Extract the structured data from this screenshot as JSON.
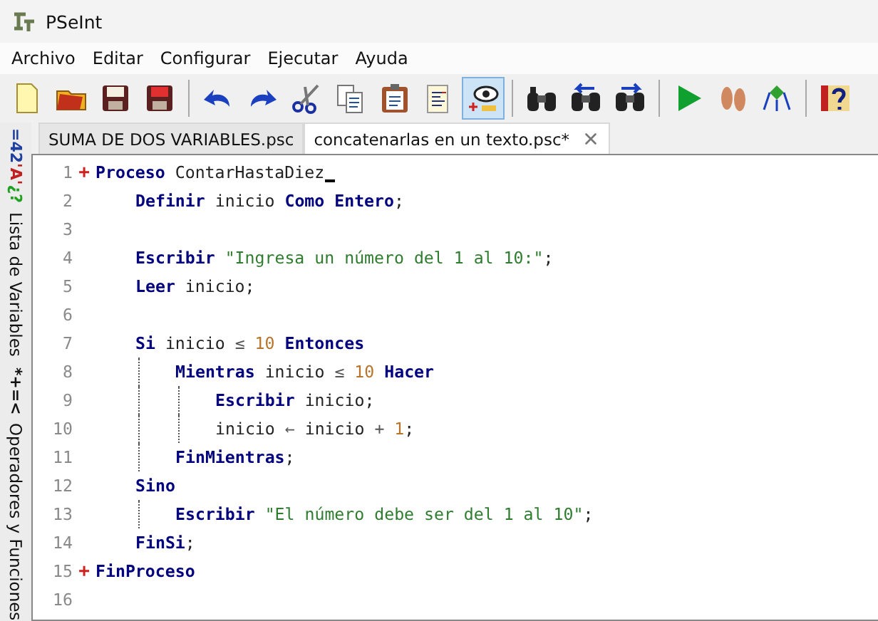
{
  "window": {
    "title": "PSeInt"
  },
  "menu": [
    "Archivo",
    "Editar",
    "Configurar",
    "Ejecutar",
    "Ayuda"
  ],
  "toolbar": [
    {
      "kind": "new",
      "selected": false
    },
    {
      "kind": "open",
      "selected": false
    },
    {
      "kind": "save",
      "selected": false
    },
    {
      "kind": "saveas",
      "selected": false
    },
    {
      "kind": "separator"
    },
    {
      "kind": "undo",
      "selected": false
    },
    {
      "kind": "redo",
      "selected": false
    },
    {
      "kind": "cut",
      "selected": false
    },
    {
      "kind": "copy",
      "selected": false
    },
    {
      "kind": "paste",
      "selected": false
    },
    {
      "kind": "document",
      "selected": false
    },
    {
      "kind": "eye",
      "selected": true
    },
    {
      "kind": "separator"
    },
    {
      "kind": "binoculars",
      "selected": false
    },
    {
      "kind": "binoculars-prev",
      "selected": false
    },
    {
      "kind": "binoculars-next",
      "selected": false
    },
    {
      "kind": "separator"
    },
    {
      "kind": "run",
      "selected": false
    },
    {
      "kind": "steps",
      "selected": false
    },
    {
      "kind": "flowchart",
      "selected": false
    },
    {
      "kind": "separator"
    },
    {
      "kind": "help",
      "selected": false
    }
  ],
  "side_panels": [
    {
      "glyphs": [
        {
          "text": "=42",
          "color": "#2040a0"
        },
        {
          "text": "'A'",
          "color": "#c02020"
        },
        {
          "text": "¿?",
          "color": "#20a020"
        }
      ],
      "label": "Lista de Variables"
    },
    {
      "glyphs": [
        {
          "text": "*+=<",
          "color": "#101010"
        }
      ],
      "label": "Operadores y Funciones"
    }
  ],
  "tabs": [
    {
      "label": "SUMA DE DOS VARIABLES.psc",
      "selected": false,
      "closable": false
    },
    {
      "label": "concatenarlas en un texto.psc*",
      "selected": true,
      "closable": true
    }
  ],
  "editor": {
    "lines": [
      {
        "number": "1",
        "fold": "+",
        "cursor": true,
        "tokens": [
          {
            "kind": "keyword",
            "text": "Proceso"
          },
          {
            "kind": "plain",
            "text": " ContarHastaDiez"
          }
        ],
        "children": [
          {
            "number": "2",
            "tokens": [
              {
                "kind": "keyword",
                "text": "Definir"
              },
              {
                "kind": "plain",
                "text": " inicio "
              },
              {
                "kind": "keyword",
                "text": "Como Entero"
              },
              {
                "kind": "plain",
                "text": ";"
              }
            ]
          },
          {
            "number": "3"
          },
          {
            "number": "4",
            "tokens": [
              {
                "kind": "keyword",
                "text": "Escribir"
              },
              {
                "kind": "string",
                "text": " \"Ingresa un número del 1 al 10:\""
              },
              {
                "kind": "plain",
                "text": ";"
              }
            ]
          },
          {
            "number": "5",
            "tokens": [
              {
                "kind": "keyword",
                "text": "Leer"
              },
              {
                "kind": "plain",
                "text": " inicio;"
              }
            ]
          },
          {
            "number": "6"
          },
          {
            "number": "7",
            "tokens": [
              {
                "kind": "keyword",
                "text": "Si"
              },
              {
                "kind": "plain",
                "text": " inicio "
              },
              {
                "kind": "operator",
                "text": "≤"
              },
              {
                "kind": "number",
                "text": " 10"
              },
              {
                "kind": "keyword",
                "text": " Entonces"
              }
            ],
            "children": [
              {
                "number": "8",
                "tokens": [
                  {
                    "kind": "keyword",
                    "text": "Mientras"
                  },
                  {
                    "kind": "plain",
                    "text": " inicio "
                  },
                  {
                    "kind": "operator",
                    "text": "≤"
                  },
                  {
                    "kind": "number",
                    "text": " 10"
                  },
                  {
                    "kind": "keyword",
                    "text": " Hacer"
                  }
                ],
                "children": [
                  {
                    "number": "9",
                    "tokens": [
                      {
                        "kind": "keyword",
                        "text": "Escribir"
                      },
                      {
                        "kind": "plain",
                        "text": " inicio;"
                      }
                    ]
                  },
                  {
                    "number": "10",
                    "tokens": [
                      {
                        "kind": "plain",
                        "text": "inicio "
                      },
                      {
                        "kind": "operator",
                        "text": "←"
                      },
                      {
                        "kind": "plain",
                        "text": " inicio "
                      },
                      {
                        "kind": "operator",
                        "text": "+"
                      },
                      {
                        "kind": "number",
                        "text": " 1"
                      },
                      {
                        "kind": "plain",
                        "text": ";"
                      }
                    ]
                  }
                ]
              },
              {
                "number": "11",
                "tokens": [
                  {
                    "kind": "keyword",
                    "text": "FinMientras"
                  },
                  {
                    "kind": "plain",
                    "text": ";"
                  }
                ]
              }
            ]
          },
          {
            "number": "12",
            "tokens": [
              {
                "kind": "keyword",
                "text": "Sino"
              }
            ],
            "children": [
              {
                "number": "13",
                "tokens": [
                  {
                    "kind": "keyword",
                    "text": "Escribir"
                  },
                  {
                    "kind": "string",
                    "text": " \"El número debe ser del 1 al 10\""
                  },
                  {
                    "kind": "plain",
                    "text": ";"
                  }
                ]
              }
            ]
          },
          {
            "number": "14",
            "tokens": [
              {
                "kind": "keyword",
                "text": "FinSi"
              },
              {
                "kind": "plain",
                "text": ";"
              }
            ]
          }
        ]
      },
      {
        "number": "15",
        "fold": "+",
        "tokens": [
          {
            "kind": "keyword",
            "text": "FinProceso"
          }
        ]
      },
      {
        "number": "16"
      }
    ]
  }
}
